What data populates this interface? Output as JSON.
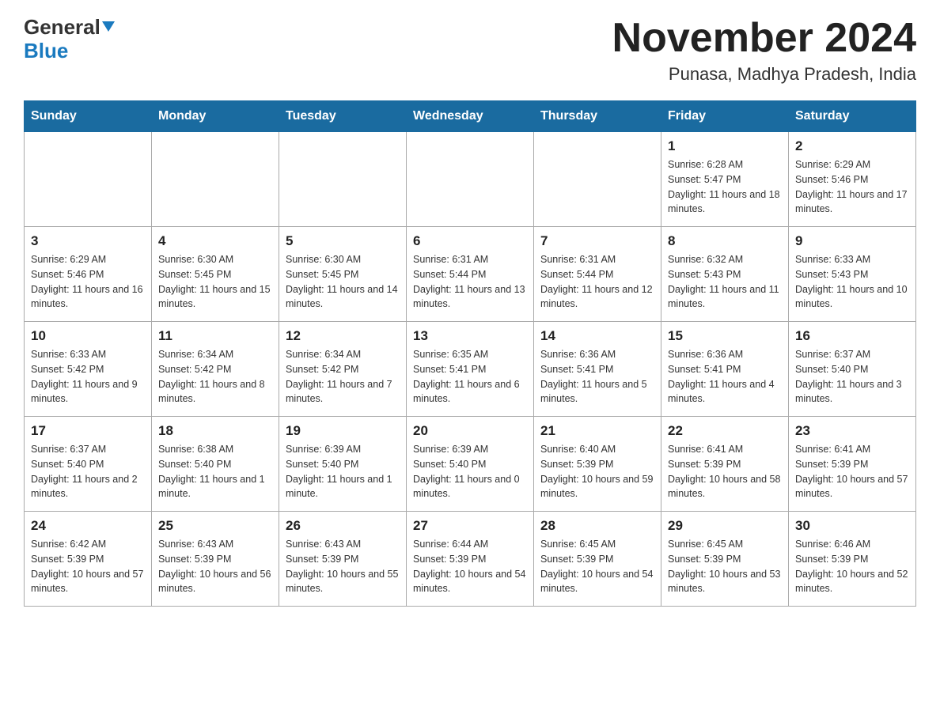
{
  "header": {
    "logo_general": "General",
    "logo_blue": "Blue",
    "month_title": "November 2024",
    "location": "Punasa, Madhya Pradesh, India"
  },
  "weekdays": [
    "Sunday",
    "Monday",
    "Tuesday",
    "Wednesday",
    "Thursday",
    "Friday",
    "Saturday"
  ],
  "weeks": [
    [
      {
        "day": "",
        "info": ""
      },
      {
        "day": "",
        "info": ""
      },
      {
        "day": "",
        "info": ""
      },
      {
        "day": "",
        "info": ""
      },
      {
        "day": "",
        "info": ""
      },
      {
        "day": "1",
        "info": "Sunrise: 6:28 AM\nSunset: 5:47 PM\nDaylight: 11 hours and 18 minutes."
      },
      {
        "day": "2",
        "info": "Sunrise: 6:29 AM\nSunset: 5:46 PM\nDaylight: 11 hours and 17 minutes."
      }
    ],
    [
      {
        "day": "3",
        "info": "Sunrise: 6:29 AM\nSunset: 5:46 PM\nDaylight: 11 hours and 16 minutes."
      },
      {
        "day": "4",
        "info": "Sunrise: 6:30 AM\nSunset: 5:45 PM\nDaylight: 11 hours and 15 minutes."
      },
      {
        "day": "5",
        "info": "Sunrise: 6:30 AM\nSunset: 5:45 PM\nDaylight: 11 hours and 14 minutes."
      },
      {
        "day": "6",
        "info": "Sunrise: 6:31 AM\nSunset: 5:44 PM\nDaylight: 11 hours and 13 minutes."
      },
      {
        "day": "7",
        "info": "Sunrise: 6:31 AM\nSunset: 5:44 PM\nDaylight: 11 hours and 12 minutes."
      },
      {
        "day": "8",
        "info": "Sunrise: 6:32 AM\nSunset: 5:43 PM\nDaylight: 11 hours and 11 minutes."
      },
      {
        "day": "9",
        "info": "Sunrise: 6:33 AM\nSunset: 5:43 PM\nDaylight: 11 hours and 10 minutes."
      }
    ],
    [
      {
        "day": "10",
        "info": "Sunrise: 6:33 AM\nSunset: 5:42 PM\nDaylight: 11 hours and 9 minutes."
      },
      {
        "day": "11",
        "info": "Sunrise: 6:34 AM\nSunset: 5:42 PM\nDaylight: 11 hours and 8 minutes."
      },
      {
        "day": "12",
        "info": "Sunrise: 6:34 AM\nSunset: 5:42 PM\nDaylight: 11 hours and 7 minutes."
      },
      {
        "day": "13",
        "info": "Sunrise: 6:35 AM\nSunset: 5:41 PM\nDaylight: 11 hours and 6 minutes."
      },
      {
        "day": "14",
        "info": "Sunrise: 6:36 AM\nSunset: 5:41 PM\nDaylight: 11 hours and 5 minutes."
      },
      {
        "day": "15",
        "info": "Sunrise: 6:36 AM\nSunset: 5:41 PM\nDaylight: 11 hours and 4 minutes."
      },
      {
        "day": "16",
        "info": "Sunrise: 6:37 AM\nSunset: 5:40 PM\nDaylight: 11 hours and 3 minutes."
      }
    ],
    [
      {
        "day": "17",
        "info": "Sunrise: 6:37 AM\nSunset: 5:40 PM\nDaylight: 11 hours and 2 minutes."
      },
      {
        "day": "18",
        "info": "Sunrise: 6:38 AM\nSunset: 5:40 PM\nDaylight: 11 hours and 1 minute."
      },
      {
        "day": "19",
        "info": "Sunrise: 6:39 AM\nSunset: 5:40 PM\nDaylight: 11 hours and 1 minute."
      },
      {
        "day": "20",
        "info": "Sunrise: 6:39 AM\nSunset: 5:40 PM\nDaylight: 11 hours and 0 minutes."
      },
      {
        "day": "21",
        "info": "Sunrise: 6:40 AM\nSunset: 5:39 PM\nDaylight: 10 hours and 59 minutes."
      },
      {
        "day": "22",
        "info": "Sunrise: 6:41 AM\nSunset: 5:39 PM\nDaylight: 10 hours and 58 minutes."
      },
      {
        "day": "23",
        "info": "Sunrise: 6:41 AM\nSunset: 5:39 PM\nDaylight: 10 hours and 57 minutes."
      }
    ],
    [
      {
        "day": "24",
        "info": "Sunrise: 6:42 AM\nSunset: 5:39 PM\nDaylight: 10 hours and 57 minutes."
      },
      {
        "day": "25",
        "info": "Sunrise: 6:43 AM\nSunset: 5:39 PM\nDaylight: 10 hours and 56 minutes."
      },
      {
        "day": "26",
        "info": "Sunrise: 6:43 AM\nSunset: 5:39 PM\nDaylight: 10 hours and 55 minutes."
      },
      {
        "day": "27",
        "info": "Sunrise: 6:44 AM\nSunset: 5:39 PM\nDaylight: 10 hours and 54 minutes."
      },
      {
        "day": "28",
        "info": "Sunrise: 6:45 AM\nSunset: 5:39 PM\nDaylight: 10 hours and 54 minutes."
      },
      {
        "day": "29",
        "info": "Sunrise: 6:45 AM\nSunset: 5:39 PM\nDaylight: 10 hours and 53 minutes."
      },
      {
        "day": "30",
        "info": "Sunrise: 6:46 AM\nSunset: 5:39 PM\nDaylight: 10 hours and 52 minutes."
      }
    ]
  ]
}
